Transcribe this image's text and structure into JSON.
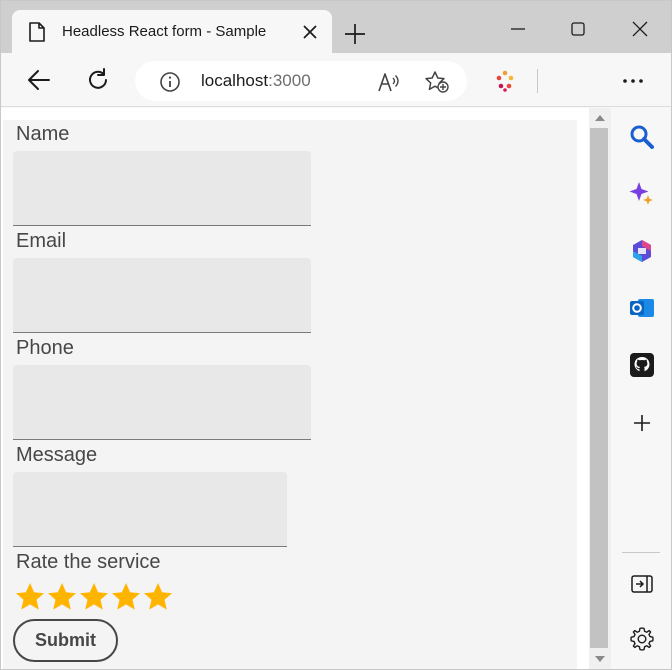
{
  "browser": {
    "tab_title": "Headless React form - Sample",
    "url_host": "localhost",
    "url_port": ":3000"
  },
  "form": {
    "name_label": "Name",
    "email_label": "Email",
    "phone_label": "Phone",
    "message_label": "Message",
    "rating_label": "Rate the service",
    "rating_value": 5,
    "rating_max": 5,
    "submit_label": "Submit"
  },
  "colors": {
    "star": "#ffb400",
    "input_bg": "#e8e8e8",
    "label_text": "#474747"
  }
}
